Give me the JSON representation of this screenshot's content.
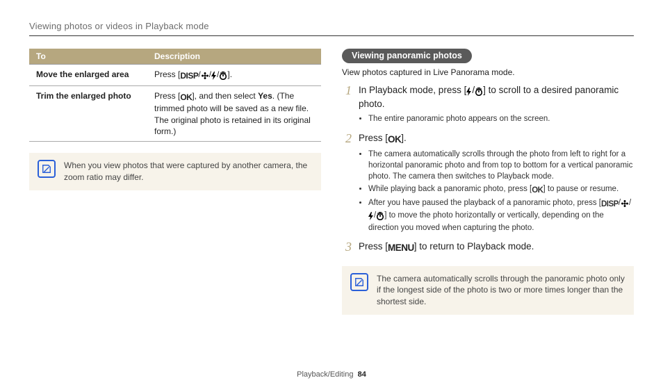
{
  "header": {
    "title": "Viewing photos or videos in Playback mode"
  },
  "table": {
    "headers": [
      "To",
      "Description"
    ],
    "rows": [
      {
        "label": "Move the enlarged area",
        "desc_pre": "Press [",
        "desc_post": "]."
      },
      {
        "label": "Trim the enlarged photo",
        "desc_pre": "Press [",
        "desc_mid": "], and then select ",
        "desc_yes": "Yes",
        "desc_post2": ". (The trimmed photo will be saved as a new file. The original photo is retained in its original form.)"
      }
    ]
  },
  "note1": "When you view photos that were captured by another camera, the zoom ratio may differ.",
  "panorama": {
    "pill": "Viewing panoramic photos",
    "intro": "View photos captured in Live Panorama mode.",
    "steps": [
      {
        "num": "1",
        "title_pre": "In Playback mode, press [",
        "title_post": "] to scroll to a desired panoramic photo.",
        "subs": [
          "The entire panoramic photo appears on the screen."
        ]
      },
      {
        "num": "2",
        "title_pre": "Press [",
        "title_post": "].",
        "subs": [
          "The camera automatically scrolls through the photo from left to right for a horizontal panoramic photo and from top to bottom for a vertical panoramic photo. The camera then switches to Playback mode."
        ],
        "sub_pause_pre": "While playing back a panoramic photo, press [",
        "sub_pause_post": "] to pause or resume.",
        "sub_after_pre": "After you have paused the playback of a panoramic photo, press [",
        "sub_after_post": "] to move the photo horizontally or vertically, depending on the direction you moved when capturing the photo."
      },
      {
        "num": "3",
        "title_pre": "Press [",
        "title_post": "] to return to Playback mode."
      }
    ],
    "note2": "The camera automatically scrolls through the panoramic photo only if the longest side of the photo is two or more times longer than the shortest side."
  },
  "footer": {
    "section": "Playback/Editing",
    "page": "84"
  },
  "glyphs": {
    "disp": "DISP",
    "ok": "OK",
    "menu": "MENU"
  }
}
